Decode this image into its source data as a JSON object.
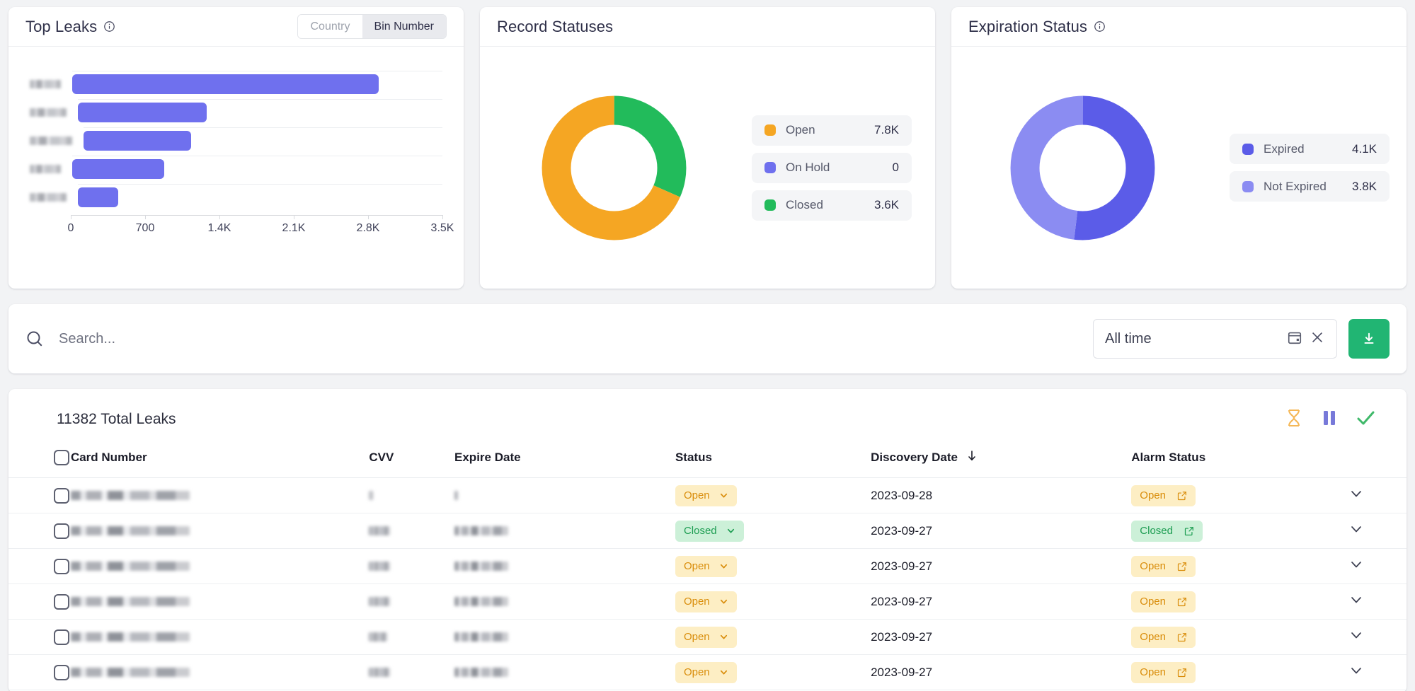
{
  "top_leaks": {
    "title": "Top Leaks",
    "info_icon": "info-icon",
    "toggle": {
      "country": "Country",
      "bin_number": "Bin Number",
      "selected": "Bin Number"
    }
  },
  "record_statuses": {
    "title": "Record Statuses"
  },
  "expiration_status": {
    "title": "Expiration Status",
    "info_icon": "info-icon"
  },
  "search": {
    "placeholder": "Search...",
    "value": "",
    "icon": "search-icon"
  },
  "date_filter": {
    "value": "All time",
    "calendar_icon": "calendar-icon",
    "clear_icon": "close-icon"
  },
  "download_button": {
    "icon": "download-icon"
  },
  "table": {
    "title": "11382 Total Leaks",
    "actions": [
      {
        "name": "hourglass-icon",
        "color": "#f5b858"
      },
      {
        "name": "pause-icon",
        "color": "#7779d9"
      },
      {
        "name": "check-icon",
        "color": "#3fb96a"
      }
    ],
    "columns": [
      "Card Number",
      "CVV",
      "Expire Date",
      "Status",
      "Discovery Date",
      "Alarm Status"
    ],
    "sorted_column": "Discovery Date",
    "sort_direction": "desc",
    "rows": [
      {
        "card_number": "",
        "cvv": "",
        "expire_date": "",
        "status": "Open",
        "discovery_date": "2023-09-28",
        "alarm_status": "Open",
        "redacted": true,
        "cvv_width": 6,
        "exp_width": 5
      },
      {
        "card_number": "",
        "cvv": "",
        "expire_date": "",
        "status": "Closed",
        "discovery_date": "2023-09-27",
        "alarm_status": "Closed",
        "redacted": true,
        "cvv_width": 30,
        "exp_width": 76
      },
      {
        "card_number": "",
        "cvv": "",
        "expire_date": "",
        "status": "Open",
        "discovery_date": "2023-09-27",
        "alarm_status": "Open",
        "redacted": true,
        "cvv_width": 30,
        "exp_width": 76
      },
      {
        "card_number": "",
        "cvv": "",
        "expire_date": "",
        "status": "Open",
        "discovery_date": "2023-09-27",
        "alarm_status": "Open",
        "redacted": true,
        "cvv_width": 30,
        "exp_width": 76
      },
      {
        "card_number": "",
        "cvv": "",
        "expire_date": "",
        "status": "Open",
        "discovery_date": "2023-09-27",
        "alarm_status": "Open",
        "redacted": true,
        "cvv_width": 26,
        "exp_width": 76
      },
      {
        "card_number": "",
        "cvv": "",
        "expire_date": "",
        "status": "Open",
        "discovery_date": "2023-09-27",
        "alarm_status": "Open",
        "redacted": true,
        "cvv_width": 30,
        "exp_width": 76
      }
    ]
  },
  "colors": {
    "bar_purple": "#6f70ee",
    "orange": "#f5a623",
    "green": "#22bb5b",
    "purple": "#6f70ee",
    "purple_light": "#8b8cf2",
    "accent_green": "#21b573"
  },
  "chart_data": [
    {
      "type": "bar",
      "title": "Top Leaks",
      "orientation": "horizontal",
      "categories": [
        "[redacted]",
        "[redacted]",
        "[redacted]",
        "[redacted]",
        "[redacted]"
      ],
      "values": [
        2900,
        1240,
        1050,
        870,
        390
      ],
      "xlabel": "",
      "ylabel": "",
      "xlim": [
        0,
        3500
      ],
      "xticks": [
        0,
        700,
        1400,
        2100,
        2800,
        3500
      ],
      "xtick_labels": [
        "0",
        "700",
        "1.4K",
        "2.1K",
        "2.8K",
        "3.5K"
      ],
      "grid": true,
      "legend": "none",
      "series_color": "#6f70ee"
    },
    {
      "type": "pie",
      "title": "Record Statuses",
      "donut": true,
      "labels": [
        "Open",
        "On Hold",
        "Closed"
      ],
      "values": [
        7.8,
        0,
        3.6
      ],
      "value_labels": [
        "7.8K",
        "0",
        "3.6K"
      ],
      "colors": [
        "#f5a623",
        "#6f70ee",
        "#22bb5b"
      ],
      "legend": "right"
    },
    {
      "type": "pie",
      "title": "Expiration Status",
      "donut": true,
      "labels": [
        "Expired",
        "Not Expired"
      ],
      "values": [
        4.1,
        3.8
      ],
      "value_labels": [
        "4.1K",
        "3.8K"
      ],
      "colors": [
        "#5b5ce8",
        "#8b8cf2"
      ],
      "legend": "right"
    }
  ]
}
